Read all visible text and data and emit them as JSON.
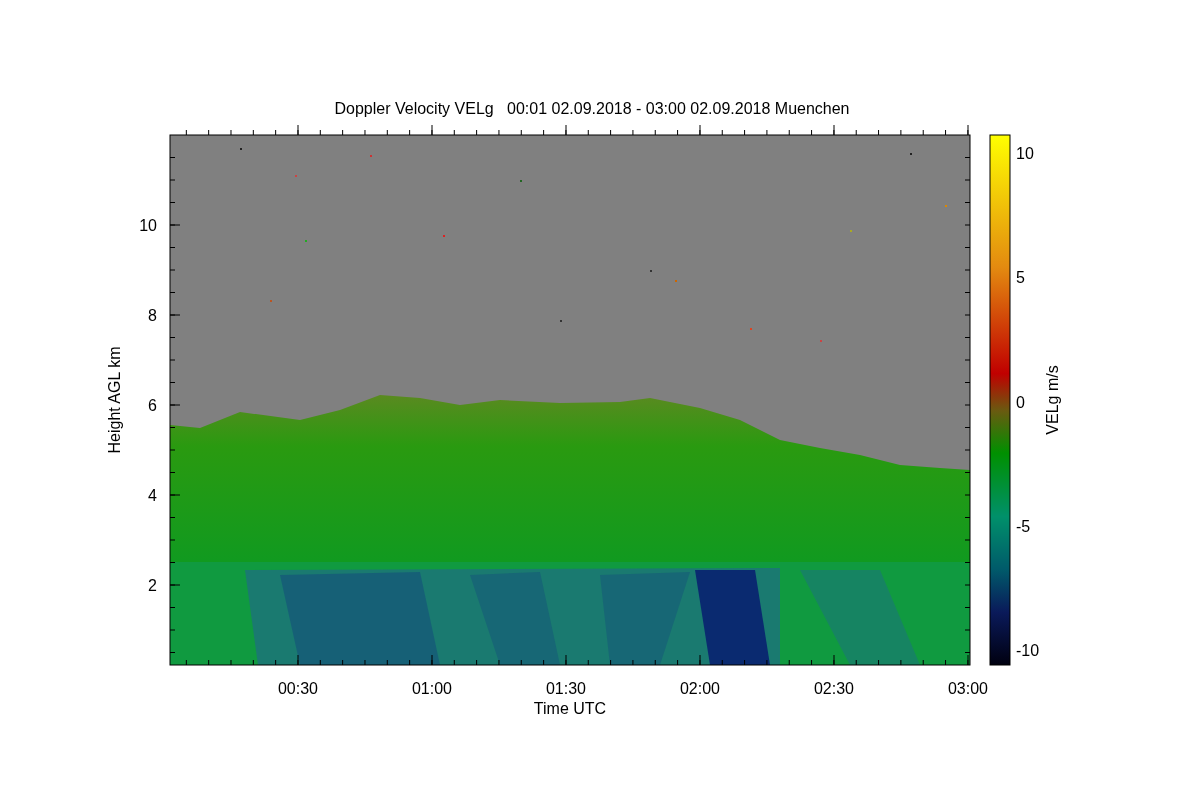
{
  "title": "Doppler Velocity VELg   00:01 02.09.2018 - 03:00 02.09.2018 Muenchen",
  "y_axis": {
    "label": "Height AGL km",
    "ticks": [
      "10",
      "8",
      "6",
      "4",
      "2"
    ]
  },
  "x_axis": {
    "label": "Time UTC",
    "ticks": [
      "00:30",
      "01:00",
      "01:30",
      "02:00",
      "02:30",
      "03:00"
    ]
  },
  "colorbar": {
    "label": "VELg m/s",
    "ticks": [
      "10",
      "5",
      "0",
      "-5",
      "-10"
    ]
  }
}
